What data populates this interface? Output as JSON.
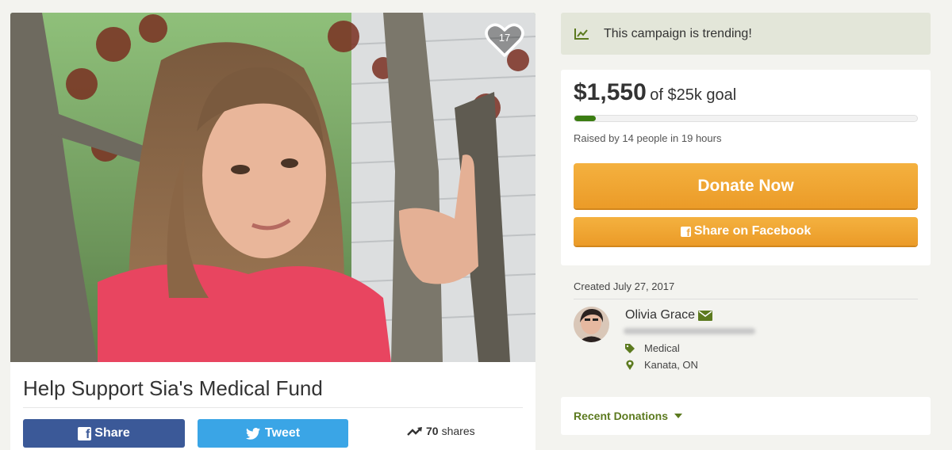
{
  "campaign": {
    "title": "Help Support Sia's Medical Fund",
    "heart_count": "17"
  },
  "share_bar": {
    "facebook_label": "Share",
    "tweet_label": "Tweet",
    "shares_count": "70",
    "shares_label": "shares"
  },
  "trending": {
    "text": "This campaign is trending!",
    "icon": "trending-line-icon"
  },
  "donation": {
    "amount": "$1,550",
    "goal_text": "of $25k goal",
    "progress_fraction": 0.062,
    "raised_by": "Raised by 14 people in 19 hours",
    "donate_label": "Donate Now",
    "share_facebook_label": "Share on Facebook"
  },
  "organizer": {
    "created": "Created July 27, 2017",
    "name": "Olivia Grace",
    "category": "Medical",
    "location": "Kanata, ON"
  },
  "recent_donations": {
    "label": "Recent Donations"
  },
  "colors": {
    "accent_green": "#5c7a1f",
    "progress_green": "#3b7d12",
    "donate_orange": "#f0a63c",
    "facebook_blue": "#3b5998",
    "twitter_blue": "#3aa5e6"
  }
}
